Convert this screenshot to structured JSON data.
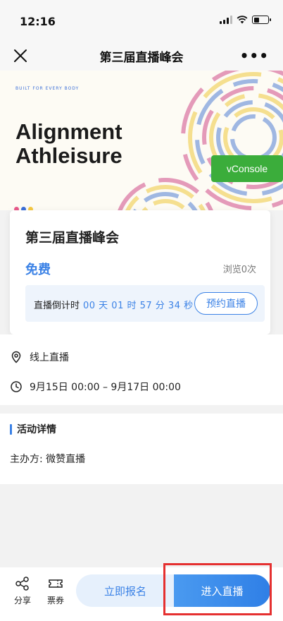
{
  "status_bar": {
    "time": "12:16"
  },
  "nav": {
    "title": "第三届直播峰会",
    "more": "•••",
    "close_icon": "close-icon"
  },
  "banner": {
    "tag": "BUILT FOR EVERY BODY",
    "title_line1": "Alignment",
    "title_line2": "Athleisure",
    "vconsole": "vConsole",
    "accent_colors": [
      "#e49ab9",
      "#f5df8f",
      "#9fb7e2"
    ]
  },
  "event": {
    "title": "第三届直播峰会",
    "price": "免费",
    "views": "浏览0次",
    "countdown_label": "直播倒计时",
    "countdown_value": "00 天 01 时 57 分 34 秒",
    "reserve_button": "预约直播"
  },
  "details": {
    "location": "线上直播",
    "time_range": "9月15日 00:00 – 9月17日 00:00"
  },
  "activity": {
    "heading": "活动详情",
    "organizer": "主办方: 微赞直播"
  },
  "bottom_bar": {
    "share": "分享",
    "tickets": "票券",
    "signup": "立即报名",
    "enter": "进入直播"
  },
  "colors": {
    "primary": "#3b82e6",
    "highlight": "#e53030",
    "vconsole": "#3bad3b"
  }
}
